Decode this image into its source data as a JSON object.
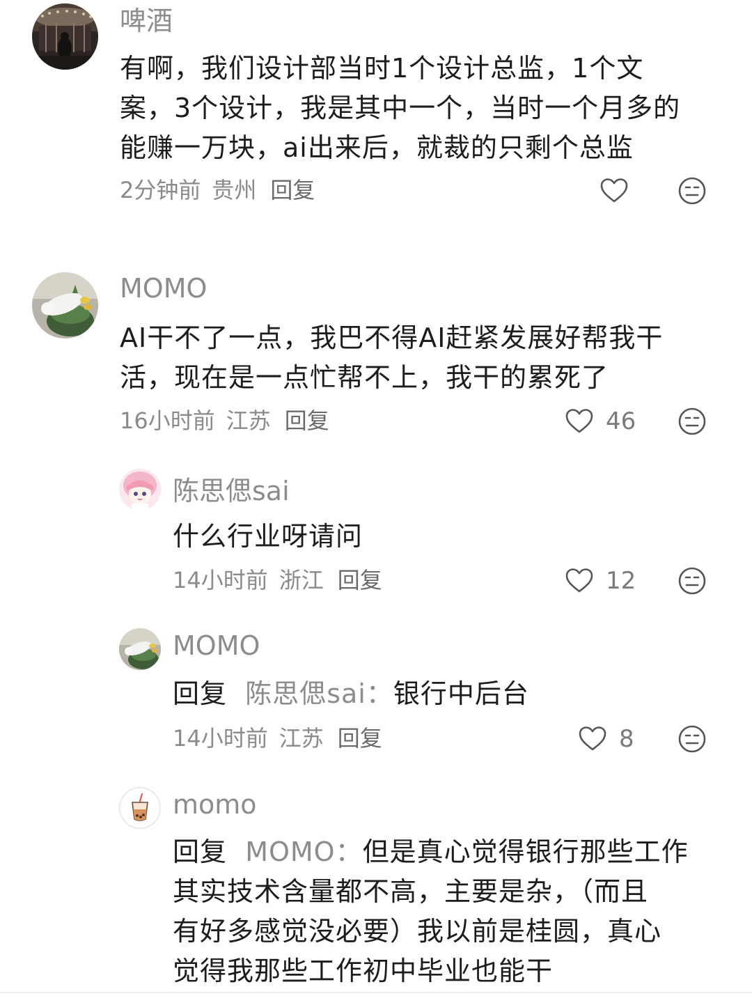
{
  "comments": [
    {
      "user": "啤酒",
      "lines": [
        "有啊，我们设计部当时1个设计总监，1个文",
        "案，3个设计，我是其中一个，当时一个月多的",
        "能赚一万块，ai出来后，就裁的只剩个总监"
      ],
      "time": "2分钟前",
      "location": "贵州",
      "reply_label": "回复",
      "likes": ""
    },
    {
      "user": "MOMO",
      "lines": [
        "AI干不了一点，我巴不得AI赶紧发展好帮我干",
        "活，现在是一点忙帮不上，我干的累死了"
      ],
      "time": "16小时前",
      "location": "江苏",
      "reply_label": "回复",
      "likes": "46"
    },
    {
      "user": "陈思偲sai",
      "lines": [
        "什么行业呀请问"
      ],
      "time": "14小时前",
      "location": "浙江",
      "reply_label": "回复",
      "likes": "12"
    },
    {
      "user": "MOMO",
      "reply_prefix": "回复",
      "reply_target": "陈思偲sai：",
      "lines": [
        "银行中后台"
      ],
      "time": "14小时前",
      "location": "江苏",
      "reply_label": "回复",
      "likes": "8"
    },
    {
      "user": "momo",
      "reply_prefix": "回复",
      "reply_target": "MOMO：",
      "lines": [
        "但是真心觉得银行那些工作",
        "其实技术含量都不高，主要是杂，（而且",
        "有好多感觉没必要）我以前是桂圆，真心",
        "觉得我那些工作初中毕业也能干"
      ]
    }
  ],
  "icons": {
    "like": "heart-outline-icon",
    "dislike": "unamused-face-icon"
  },
  "colors": {
    "text": "#1c1c1c",
    "secondary": "#8c8c8c",
    "icon": "#555555"
  }
}
